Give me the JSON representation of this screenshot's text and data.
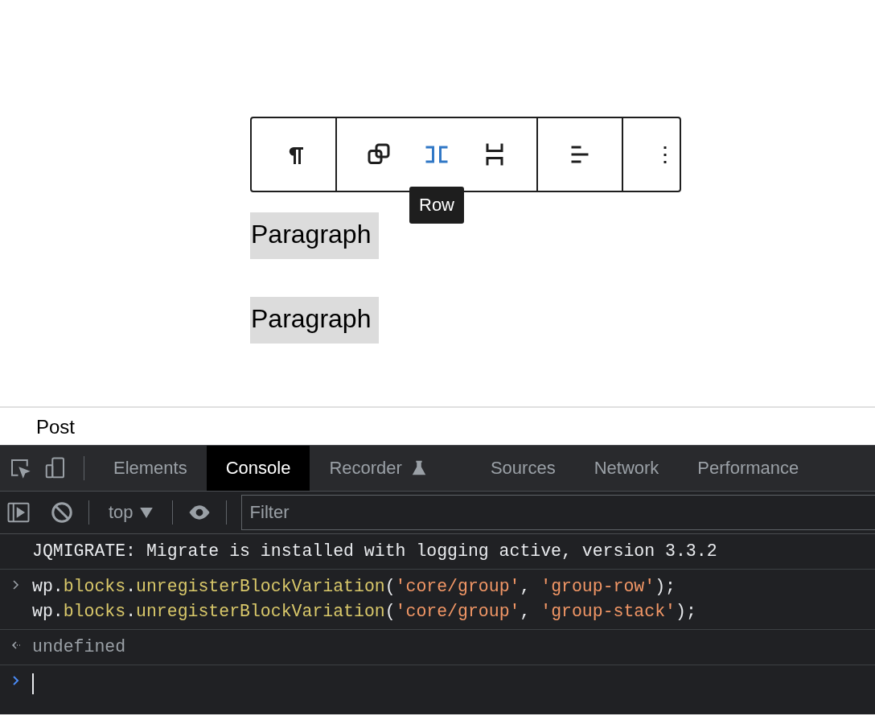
{
  "block_toolbar": {
    "groups": [
      {
        "buttons": [
          {
            "kind": "pilcrow",
            "highlighted": false
          }
        ]
      },
      {
        "buttons": [
          {
            "kind": "group",
            "highlighted": false
          },
          {
            "kind": "row",
            "highlighted": true
          },
          {
            "kind": "stack",
            "highlighted": false
          }
        ]
      },
      {
        "buttons": [
          {
            "kind": "align",
            "highlighted": false
          }
        ]
      },
      {
        "buttons": [
          {
            "kind": "more",
            "highlighted": false
          }
        ]
      }
    ],
    "tooltip": "Row"
  },
  "blocks": [
    {
      "text": "Paragraph"
    },
    {
      "text": "Paragraph"
    }
  ],
  "breadcrumb": "Post",
  "devtools": {
    "tabs": [
      {
        "label": "Elements",
        "selected": false
      },
      {
        "label": "Console",
        "selected": true
      },
      {
        "label": "Recorder",
        "selected": false,
        "flask": true
      },
      {
        "label": "Sources",
        "selected": false
      },
      {
        "label": "Network",
        "selected": false
      },
      {
        "label": "Performance",
        "selected": false
      }
    ],
    "context": "top",
    "filter_placeholder": "Filter",
    "messages": [
      {
        "kind": "log",
        "lines": [
          [
            {
              "kind": "plain",
              "text": "JQMIGRATE: Migrate is installed with logging active, version 3.3.2"
            }
          ]
        ]
      },
      {
        "kind": "input",
        "lines": [
          [
            {
              "kind": "plain",
              "text": "wp."
            },
            {
              "kind": "member",
              "text": "blocks"
            },
            {
              "kind": "plain",
              "text": "."
            },
            {
              "kind": "member",
              "text": "unregisterBlockVariation"
            },
            {
              "kind": "plain",
              "text": "("
            },
            {
              "kind": "string",
              "text": "'core/group'"
            },
            {
              "kind": "plain",
              "text": ", "
            },
            {
              "kind": "string",
              "text": "'group-row'"
            },
            {
              "kind": "plain",
              "text": ");"
            }
          ],
          [
            {
              "kind": "plain",
              "text": "wp."
            },
            {
              "kind": "member",
              "text": "blocks"
            },
            {
              "kind": "plain",
              "text": "."
            },
            {
              "kind": "member",
              "text": "unregisterBlockVariation"
            },
            {
              "kind": "plain",
              "text": "("
            },
            {
              "kind": "string",
              "text": "'core/group'"
            },
            {
              "kind": "plain",
              "text": ", "
            },
            {
              "kind": "string",
              "text": "'group-stack'"
            },
            {
              "kind": "plain",
              "text": ");"
            }
          ]
        ]
      },
      {
        "kind": "result",
        "lines": [
          [
            {
              "kind": "plain",
              "text": "undefined"
            }
          ]
        ]
      },
      {
        "kind": "prompt"
      }
    ]
  }
}
